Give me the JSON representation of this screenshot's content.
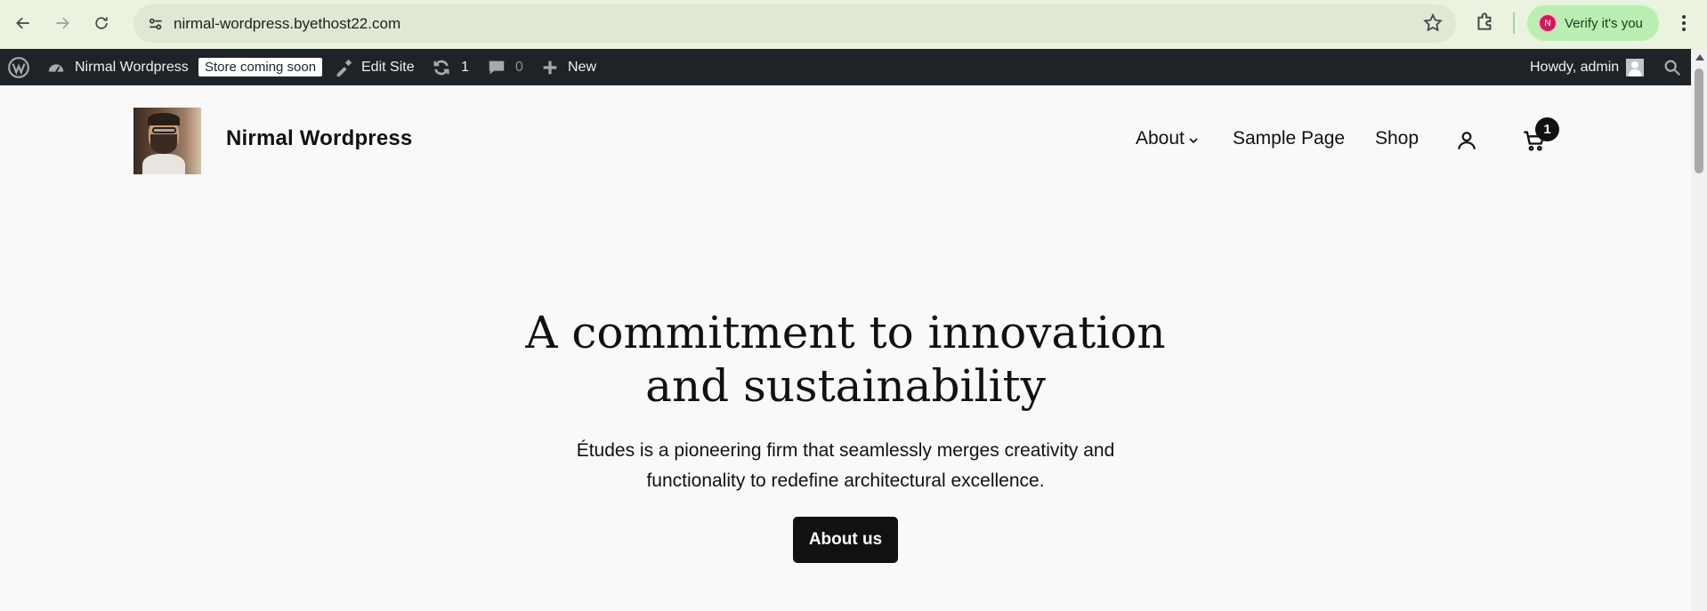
{
  "browser": {
    "url": "nirmal-wordpress.byethost22.com",
    "profile_initial": "N",
    "profile_label": "Verify it's you"
  },
  "adminbar": {
    "site_name": "Nirmal Wordpress",
    "store_badge": "Store coming soon",
    "edit_site": "Edit Site",
    "updates_count": "1",
    "comments_count": "0",
    "new_label": "New",
    "howdy": "Howdy, admin"
  },
  "header": {
    "site_title": "Nirmal Wordpress",
    "nav": {
      "about": "About",
      "sample_page": "Sample Page",
      "shop": "Shop"
    },
    "cart_count": "1"
  },
  "hero": {
    "title_line1": "A commitment to innovation",
    "title_line2": "and sustainability",
    "subtitle_line1": "Études is a pioneering firm that seamlessly merges creativity and",
    "subtitle_line2": "functionality to redefine architectural excellence.",
    "cta_label": "About us"
  },
  "colors": {
    "chrome_bg": "#eaf2e0",
    "adminbar_bg": "#1d2327",
    "page_bg": "#f9f9f9",
    "button_bg": "#111111",
    "verify_bg": "#b9efb0"
  }
}
